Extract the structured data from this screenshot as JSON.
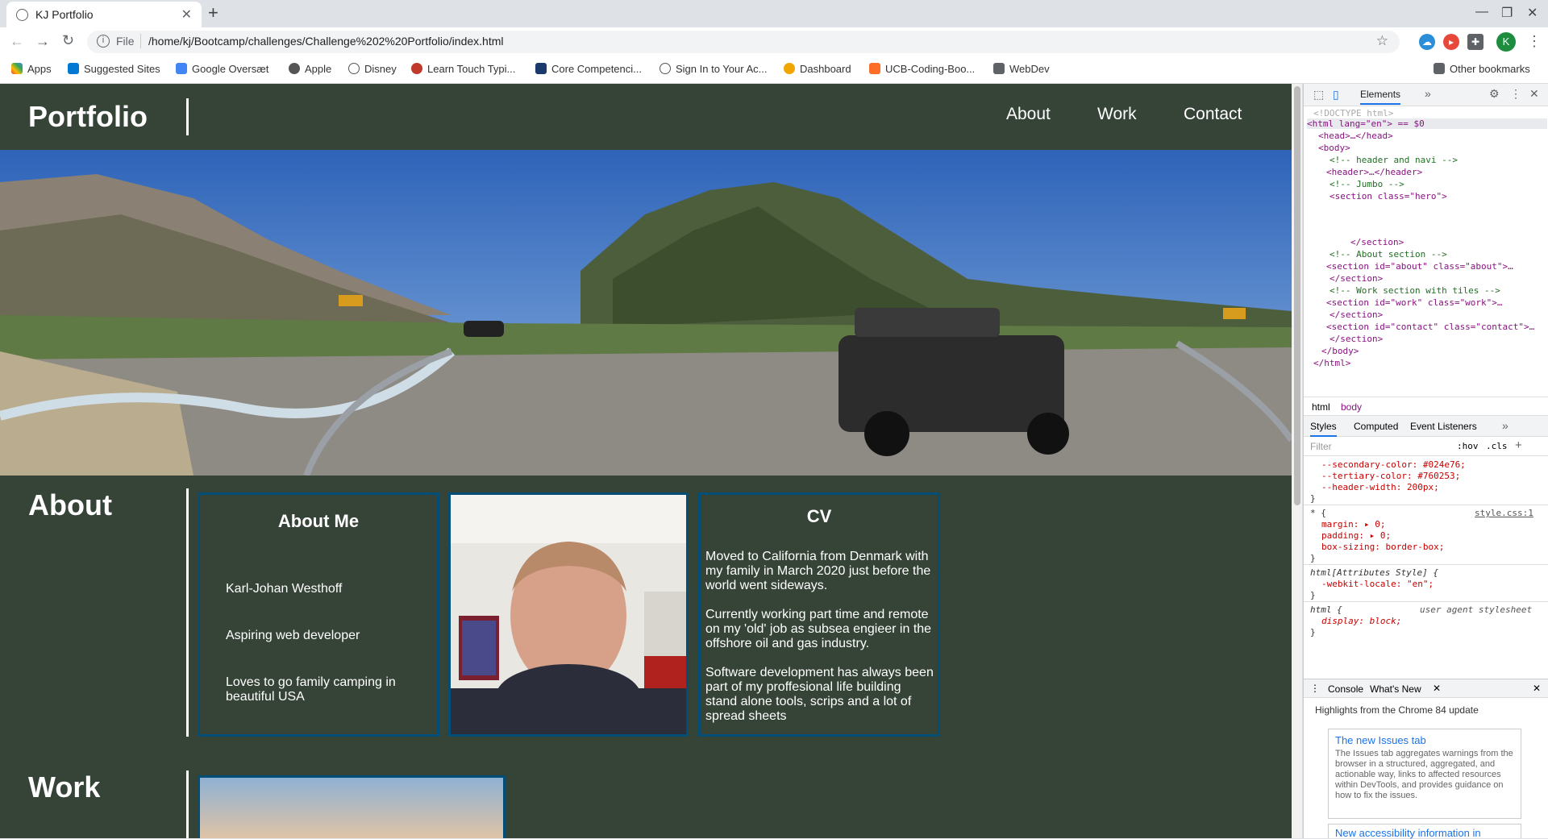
{
  "browser": {
    "tab_title": "KJ Portfolio",
    "new_tab": "+",
    "scheme": "File",
    "url": "/home/kj/Bootcamp/challenges/Challenge%202%20Portfolio/index.html",
    "profile_initial": "K",
    "bookmarks": [
      "Apps",
      "Suggested Sites",
      "Google Oversæt",
      "Apple",
      "Disney",
      "Learn Touch Typi...",
      "Core Competenci...",
      "Sign In to Your Ac...",
      "Dashboard",
      "UCB-Coding-Boo...",
      "WebDev"
    ],
    "other_bookmarks": "Other bookmarks"
  },
  "site": {
    "logo": "Portfolio",
    "nav": [
      "About",
      "Work",
      "Contact"
    ],
    "about": {
      "title": "About",
      "card1": {
        "heading": "About Me",
        "lines": [
          "Karl-Johan Westhoff",
          "Aspiring web developer",
          "Loves to go family camping in beautiful USA"
        ]
      },
      "cv": {
        "heading": "CV",
        "paragraphs": [
          "Moved to California from Denmark with my family in March 2020 just before the world went sideways.",
          "Currently working part time and remote on my 'old' job as subsea engieer in the offshore oil and gas industry.",
          "Software development has always been part of my proffesional life building stand alone tools, scrips and a lot of spread sheets"
        ]
      }
    },
    "work": {
      "title": "Work"
    }
  },
  "devtools": {
    "main_tab": "Elements",
    "dom": [
      "<!DOCTYPE html>",
      "<html lang=\"en\"> == $0",
      "<head>…</head>",
      "<body>",
      "<!-- header and navi -->",
      "<header>…</header>",
      "<!-- Jumbo -->",
      "<section class=\"hero\">",
      "</section>",
      "<!-- About section -->",
      "<section id=\"about\" class=\"about\">…",
      "</section>",
      "<!-- Work section with tiles -->",
      "<section id=\"work\" class=\"work\">…",
      "</section>",
      "<section id=\"contact\" class=\"contact\">…",
      "</section>",
      "</body>",
      "</html>"
    ],
    "breadcrumb": [
      "html",
      "body"
    ],
    "style_tabs": [
      "Styles",
      "Computed",
      "Event Listeners"
    ],
    "filter_placeholder": "Filter",
    "hov": ":hov",
    "cls": ".cls",
    "css": {
      "vars": [
        "--secondary-color: #024e76;",
        "--tertiary-color: #760253;",
        "--header-width: 200px;"
      ],
      "star_rule": {
        "selector": "* {",
        "source": "style.css:1",
        "decls": [
          "margin: ▸ 0;",
          "padding: ▸ 0;",
          "box-sizing: border-box;"
        ]
      },
      "attr_rule": {
        "selector": "html[Attributes Style] {",
        "decls": [
          "-webkit-locale: \"en\";"
        ]
      },
      "html_rule": {
        "selector": "html {",
        "source": "user agent stylesheet",
        "decls": [
          "display: block;"
        ]
      }
    },
    "drawer_tabs": [
      "Console",
      "What's New"
    ],
    "highlights": "Highlights from the Chrome 84 update",
    "card_title": "The new Issues tab",
    "card_text": "The Issues tab aggregates warnings from the browser in a structured, aggregated, and actionable way, links to affected resources within DevTools, and provides guidance on how to fix the issues.",
    "next_title": "New accessibility information in"
  },
  "colors": {
    "page_bg": "#364438",
    "card_border": "#024e76",
    "tertiary": "#760253"
  }
}
